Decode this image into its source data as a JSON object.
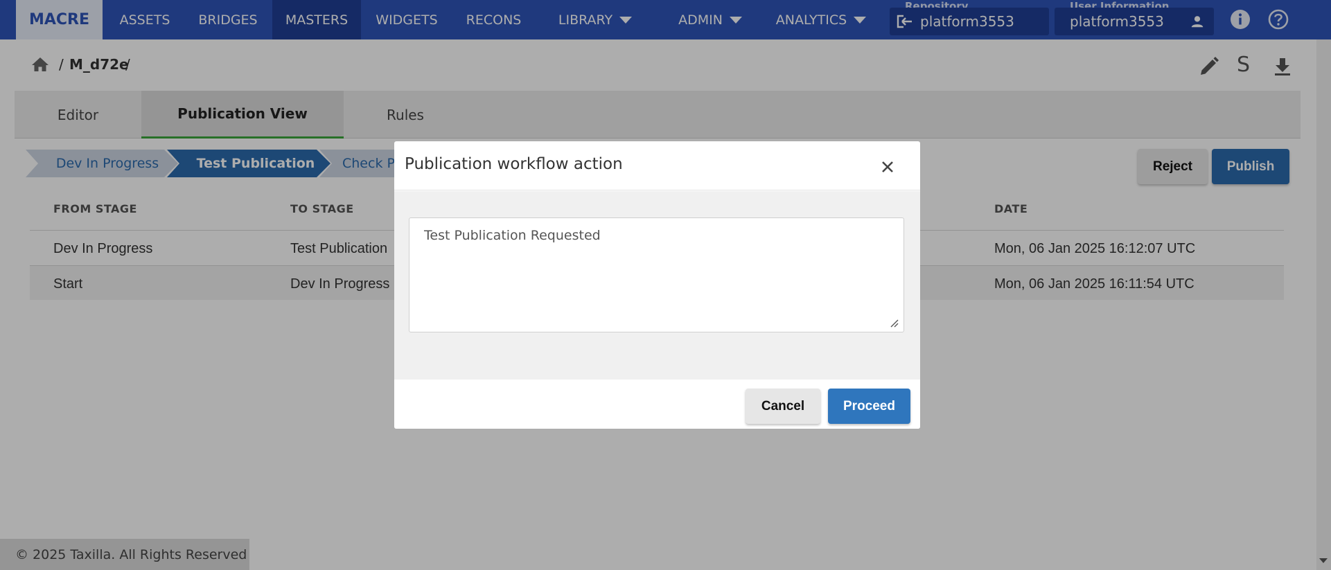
{
  "nav": {
    "brand": "MACRE",
    "items": [
      {
        "label": "ASSETS"
      },
      {
        "label": "BRIDGES"
      },
      {
        "label": "MASTERS"
      },
      {
        "label": "WIDGETS"
      },
      {
        "label": "RECONS"
      },
      {
        "label": "LIBRARY"
      },
      {
        "label": "ADMIN"
      },
      {
        "label": "ANALYTICS"
      }
    ],
    "repository_label": "Repository",
    "repository_value": "platform3553",
    "user_label": "User Information",
    "user_value": "platform3553"
  },
  "breadcrumb": {
    "separator": "/",
    "current": "M_d72e"
  },
  "toolbar": {
    "s_label": "S"
  },
  "tabs": [
    {
      "label": "Editor"
    },
    {
      "label": "Publication View"
    },
    {
      "label": "Rules"
    }
  ],
  "stages": [
    {
      "label": "Dev In Progress"
    },
    {
      "label": "Test Publication"
    },
    {
      "label": "Check Pu"
    }
  ],
  "actions": {
    "reject": "Reject",
    "publish": "Publish"
  },
  "table": {
    "headers": [
      "FROM STAGE",
      "TO STAGE",
      "DATE"
    ],
    "rows": [
      {
        "from": "Dev In Progress",
        "to": "Test Publication",
        "date": "Mon, 06 Jan 2025 16:12:07 UTC"
      },
      {
        "from": "Start",
        "to": "Dev In Progress",
        "date": "Mon, 06 Jan 2025 16:11:54 UTC"
      }
    ]
  },
  "footer": "© 2025 Taxilla. All Rights Reserved",
  "modal": {
    "title": "Publication workflow action",
    "comment": "Test Publication Requested",
    "cancel": "Cancel",
    "proceed": "Proceed"
  },
  "colors": {
    "nav": "#2e55b8",
    "nav_active": "#1f3f96",
    "stage_active": "#2c6aad",
    "stage_inactive": "#cdd6e4",
    "primary_button": "#2f76bd",
    "tab_active_underline": "#3aa63a"
  },
  "icons": [
    "home-icon",
    "pencil-icon",
    "download-icon",
    "close-icon",
    "person-icon",
    "info-icon",
    "help-icon",
    "repository-icon"
  ]
}
